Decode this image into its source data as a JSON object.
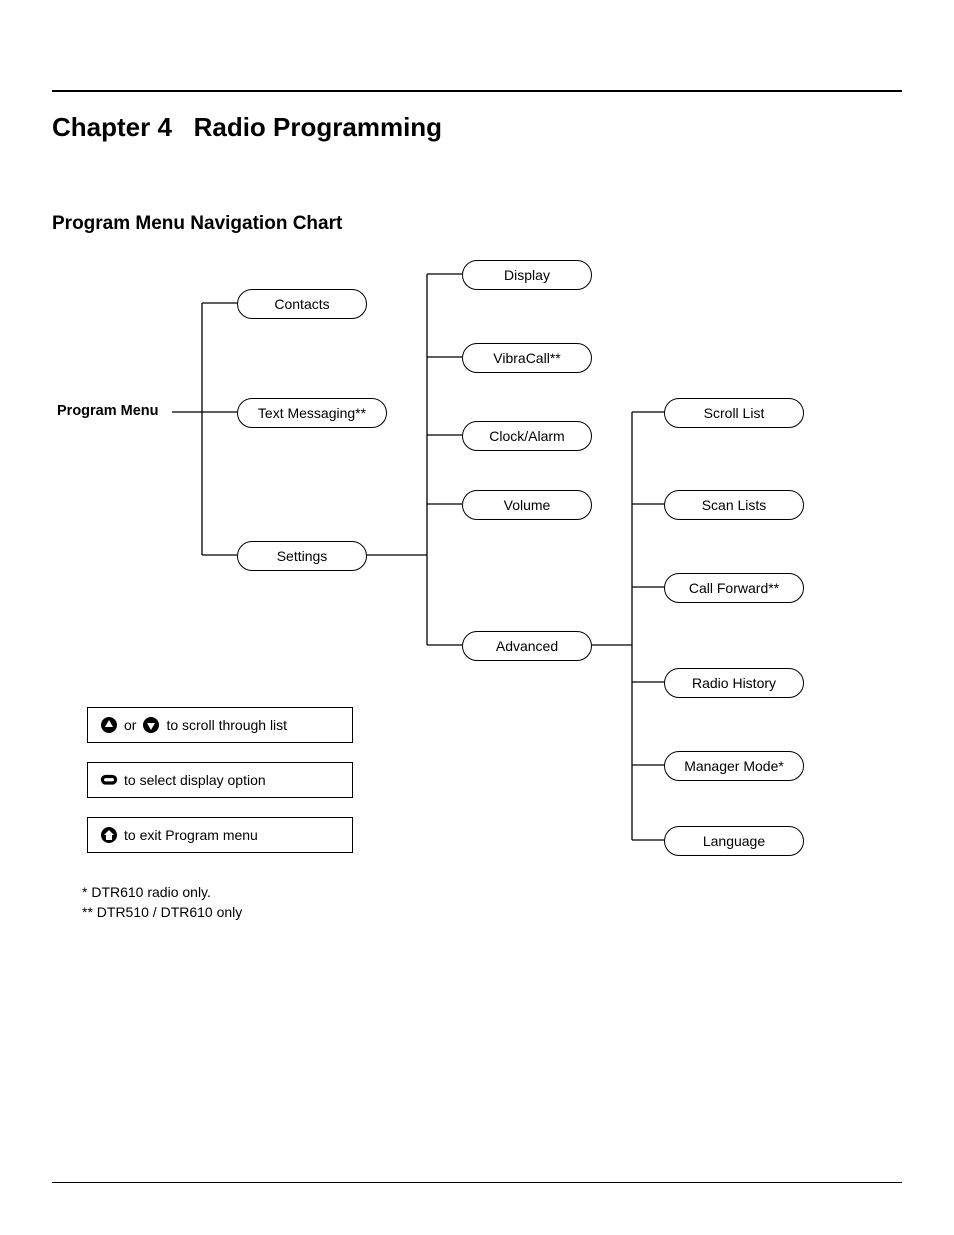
{
  "chapter": {
    "number": "Chapter 4",
    "title": "Radio Programming"
  },
  "section_title": "Program Menu Navigation Chart",
  "root_label": "Program Menu",
  "level1": {
    "contacts": "Contacts",
    "text_messaging": "Text Messaging**",
    "settings": "Settings"
  },
  "level2": {
    "display": "Display",
    "vibracall": "VibraCall**",
    "clock_alarm": "Clock/Alarm",
    "volume": "Volume",
    "advanced": "Advanced"
  },
  "level3": {
    "scroll_list": "Scroll List",
    "scan_lists": "Scan Lists",
    "call_forward": "Call Forward**",
    "radio_history": "Radio History",
    "manager_mode": "Manager Mode*",
    "language": "Language"
  },
  "legend": {
    "scroll_or": "or",
    "scroll_text": "to scroll through list",
    "select_text": "to select display option",
    "exit_text": "to exit Program menu"
  },
  "footnotes": {
    "line1": "* DTR610 radio only.",
    "line2": "** DTR510 / DTR610 only"
  }
}
